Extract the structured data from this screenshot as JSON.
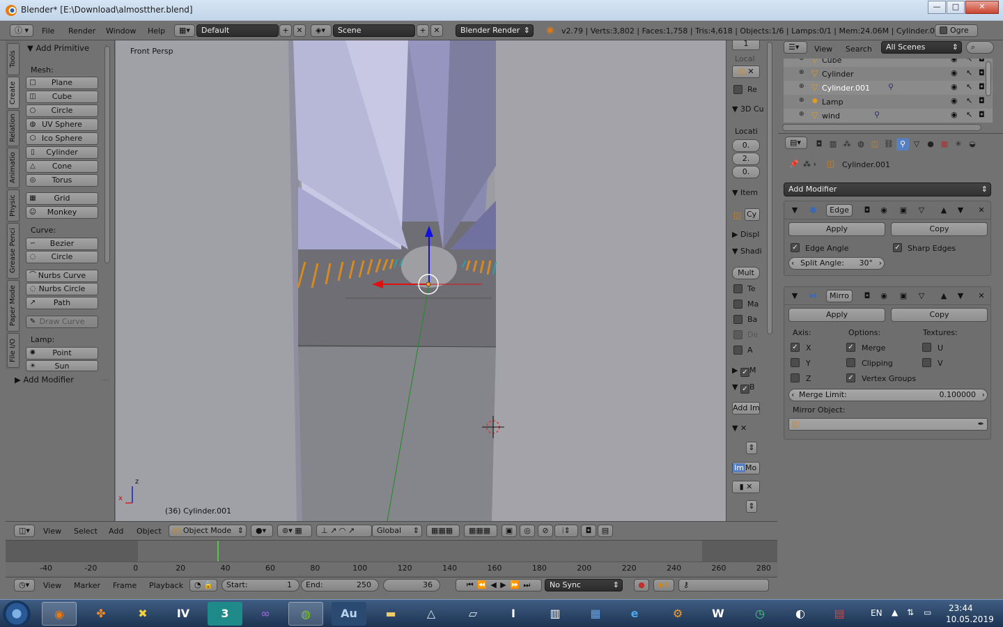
{
  "window": {
    "title": "Blender* [E:\\Download\\almostther.blend]",
    "minimize": "—",
    "maximize": "□",
    "close": "✕"
  },
  "info_header": {
    "menus": [
      "File",
      "Render",
      "Window",
      "Help"
    ],
    "screen_layout": "Default",
    "scene": "Scene",
    "render_engine": "Blender Render",
    "stats": "v2.79 | Verts:3,802 | Faces:1,758 | Tris:4,618 | Objects:1/6 | Lamps:0/1 | Mem:24.06M | Cylinder.001",
    "ogre_label": "Ogre"
  },
  "tool_tabs": [
    "Tools",
    "Create",
    "Relation",
    "Animatio",
    "Physic",
    "Grease Penci",
    "Paper Mode",
    "File I/O"
  ],
  "tool_shelf": {
    "panel_title": "Add Primitive",
    "mesh_label": "Mesh:",
    "mesh": [
      "Plane",
      "Cube",
      "Circle",
      "UV Sphere",
      "Ico Sphere",
      "Cylinder",
      "Cone",
      "Torus"
    ],
    "mesh2": [
      "Grid",
      "Monkey"
    ],
    "curve_label": "Curve:",
    "curve": [
      "Bezier",
      "Circle"
    ],
    "curve2": [
      "Nurbs Curve",
      "Nurbs Circle",
      "Path"
    ],
    "draw_curve": "Draw Curve",
    "lamp_label": "Lamp:",
    "lamp": [
      "Point",
      "Sun"
    ],
    "add_modifier": "Add Modifier"
  },
  "viewport": {
    "view_name": "Front Persp",
    "object_label": "(36) Cylinder.001",
    "axis_z": "z",
    "axis_x": "x"
  },
  "npanel": {
    "layer_value": "1",
    "local_label": "Local",
    "re_label": "Re",
    "cursor_title": "3D Cu",
    "location_label": "Locati",
    "loc_values": [
      "0.",
      "2.",
      "0."
    ],
    "item_title": "Item",
    "item_name": "Cy",
    "display_title": "Displ",
    "shading_title": "Shadi",
    "shading_mode": "Mult",
    "shading_checks": [
      "Te",
      "Ma",
      "Ba",
      "De",
      "A"
    ],
    "motion_label": "M",
    "bg_label": "B",
    "add_image": "Add Im",
    "im_label": "Im",
    "mo_label": "Mo"
  },
  "outliner": {
    "view_menu": "View",
    "search_menu": "Search",
    "filter": "All Scenes",
    "rows": [
      {
        "name": "Cube",
        "selected": false
      },
      {
        "name": "Cylinder",
        "selected": false
      },
      {
        "name": "Cylinder.001",
        "selected": true
      },
      {
        "name": "Lamp",
        "selected": false
      },
      {
        "name": "wind",
        "selected": false
      }
    ]
  },
  "properties": {
    "object_name": "Cylinder.001",
    "add_modifier": "Add Modifier",
    "edge_split": {
      "name": "Edge",
      "apply": "Apply",
      "copy": "Copy",
      "edge_angle": "Edge Angle",
      "sharp_edges": "Sharp Edges",
      "split_angle_label": "Split Angle:",
      "split_angle_value": "30°"
    },
    "mirror": {
      "name": "Mirro",
      "apply": "Apply",
      "copy": "Copy",
      "axis_label": "Axis:",
      "options_label": "Options:",
      "textures_label": "Textures:",
      "x": "X",
      "y": "Y",
      "z": "Z",
      "merge": "Merge",
      "clipping": "Clipping",
      "vertex_groups": "Vertex Groups",
      "u": "U",
      "v": "V",
      "merge_limit_label": "Merge Limit:",
      "merge_limit_value": "0.100000",
      "mirror_object_label": "Mirror Object:"
    }
  },
  "view3d_header": {
    "menus": [
      "View",
      "Select",
      "Add",
      "Object"
    ],
    "mode": "Object Mode",
    "orientation": "Global"
  },
  "timeline": {
    "ticks": [
      "-40",
      "-20",
      "0",
      "20",
      "40",
      "60",
      "80",
      "100",
      "120",
      "140",
      "160",
      "180",
      "200",
      "220",
      "240",
      "260",
      "280"
    ],
    "menus": [
      "View",
      "Marker",
      "Frame",
      "Playback"
    ],
    "start_label": "Start:",
    "start_value": "1",
    "end_label": "End:",
    "end_value": "250",
    "current_frame": "36",
    "sync": "No Sync"
  },
  "taskbar": {
    "apps": [
      "blender",
      "network",
      "xnview",
      "iv",
      "3dsmax",
      "visual-studio",
      "google-earth",
      "audition",
      "explorer",
      "vector",
      "paper",
      "intellij",
      "piano",
      "soundboard",
      "ie",
      "settings",
      "word",
      "clock",
      "steam",
      "winrar"
    ],
    "app_labels": {
      "iv": "IV",
      "3dsmax": "3",
      "audition": "Au",
      "word": "W"
    },
    "language": "EN",
    "time": "23:44",
    "date": "10.05.2019"
  }
}
